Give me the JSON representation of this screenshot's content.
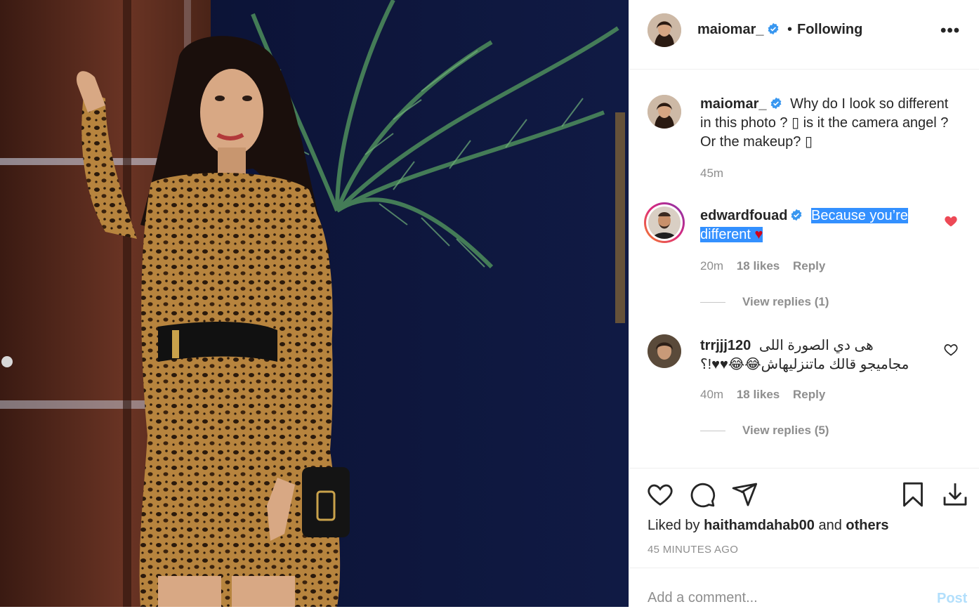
{
  "post": {
    "author": "maiomar_",
    "follow_separator": "•",
    "follow_status": "Following",
    "more_label": "•••"
  },
  "caption": {
    "username": "maiomar_",
    "text": "Why do I look so different in this photo ? ▯ is it the camera angel ? Or the makeup? ▯",
    "time": "45m"
  },
  "comments": [
    {
      "username": "edwardfouad",
      "text": "Because you’re different",
      "emoji": "♥",
      "time": "20m",
      "likes": "18 likes",
      "reply_label": "Reply",
      "view_replies": "View replies (1)",
      "liked": true
    },
    {
      "username": "trrjjj120",
      "text": "هى دي الصورة اللى مجاميجو قالك ماتنزليهاش😂😂♥♥!؟",
      "time": "40m",
      "likes": "18 likes",
      "reply_label": "Reply",
      "view_replies": "View replies (5)",
      "liked": false
    }
  ],
  "actions": {
    "liked_by_prefix": "Liked by",
    "liked_by_user": "haithamdahab00",
    "liked_by_and": "and",
    "liked_by_others": "others",
    "time_ago": "45 MINUTES AGO"
  },
  "add_comment": {
    "placeholder": "Add a comment...",
    "post_label": "Post"
  },
  "colors": {
    "verified": "#3897f0",
    "like_red": "#ed4956",
    "link_blue_disabled": "#b2dffc",
    "highlight": "#3390ff"
  },
  "icons": [
    "heart-icon",
    "comment-icon",
    "share-icon",
    "bookmark-icon",
    "download-icon",
    "verified-icon",
    "more-icon"
  ]
}
